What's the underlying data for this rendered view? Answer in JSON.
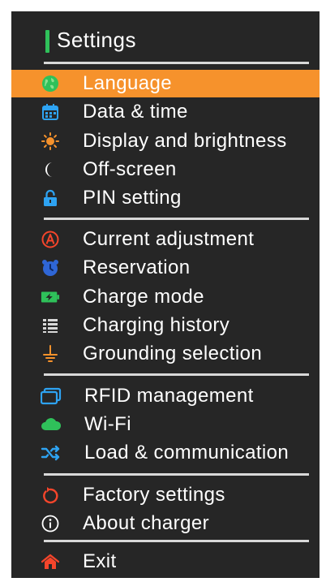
{
  "header": {
    "title": "Settings"
  },
  "groups": [
    [
      {
        "label": "Language",
        "icon": "globe-icon",
        "selected": true
      },
      {
        "label": "Data & time",
        "icon": "calendar-icon"
      },
      {
        "label": "Display and brightness",
        "icon": "sun-icon"
      },
      {
        "label": "Off-screen",
        "icon": "moon-icon"
      },
      {
        "label": "PIN setting",
        "icon": "lock-icon"
      }
    ],
    [
      {
        "label": "Current adjustment",
        "icon": "current-a-icon"
      },
      {
        "label": "Reservation",
        "icon": "alarm-clock-icon"
      },
      {
        "label": "Charge mode",
        "icon": "battery-icon"
      },
      {
        "label": "Charging history",
        "icon": "list-icon"
      },
      {
        "label": "Grounding selection",
        "icon": "ground-icon"
      }
    ],
    [
      {
        "label": "RFID management",
        "icon": "rfid-card-icon"
      },
      {
        "label": "Wi-Fi",
        "icon": "cloud-icon"
      },
      {
        "label": "Load & communication",
        "icon": "shuffle-icon"
      }
    ],
    [
      {
        "label": "Factory settings",
        "icon": "reset-icon"
      },
      {
        "label": "About charger",
        "icon": "info-icon"
      }
    ],
    [
      {
        "label": "Exit",
        "icon": "home-icon"
      }
    ]
  ],
  "colors": {
    "background": "#262626",
    "selected": "#f6922c",
    "accent": "#2fc15a",
    "divider": "#d8d8d8"
  }
}
